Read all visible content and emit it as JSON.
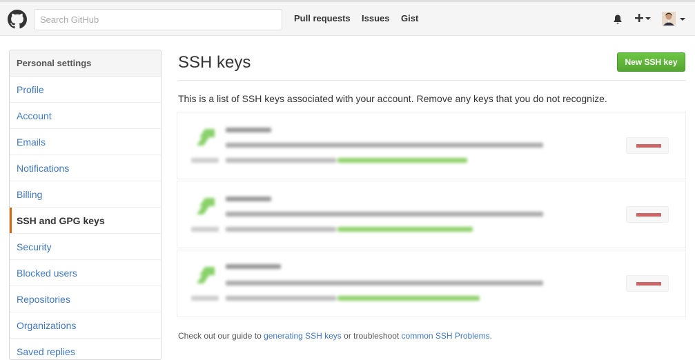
{
  "header": {
    "search_placeholder": "Search GitHub",
    "nav": [
      "Pull requests",
      "Issues",
      "Gist"
    ]
  },
  "sidebar": {
    "heading": "Personal settings",
    "items": [
      {
        "label": "Profile",
        "selected": false
      },
      {
        "label": "Account",
        "selected": false
      },
      {
        "label": "Emails",
        "selected": false
      },
      {
        "label": "Notifications",
        "selected": false
      },
      {
        "label": "Billing",
        "selected": false
      },
      {
        "label": "SSH and GPG keys",
        "selected": true
      },
      {
        "label": "Security",
        "selected": false
      },
      {
        "label": "Blocked users",
        "selected": false
      },
      {
        "label": "Repositories",
        "selected": false
      },
      {
        "label": "Organizations",
        "selected": false
      },
      {
        "label": "Saved replies",
        "selected": false
      }
    ]
  },
  "main": {
    "title": "SSH keys",
    "new_button": "New SSH key",
    "description": "This is a list of SSH keys associated with your account. Remove any keys that you do not recognize.",
    "footer": {
      "prefix": "Check out our guide to ",
      "link1": "generating SSH keys",
      "middle": " or troubleshoot ",
      "link2": "common SSH Problems",
      "suffix": "."
    }
  },
  "colors": {
    "accent": "#4078c0",
    "brand_green": "#6cc644",
    "selected_bar": "#d26911"
  }
}
